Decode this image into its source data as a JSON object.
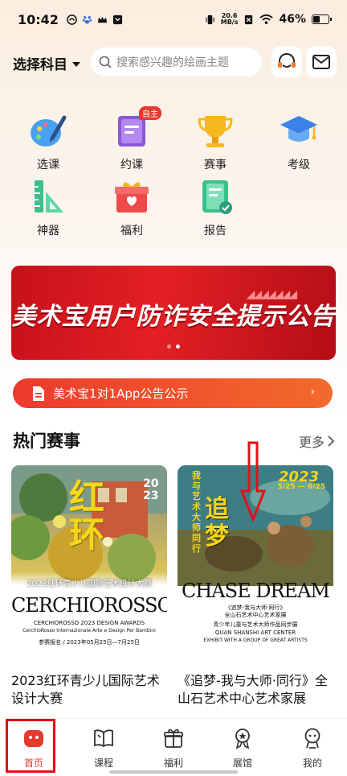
{
  "status": {
    "time": "10:42",
    "speed_top": "20.6",
    "speed_bottom": "MB/s",
    "battery": "46%"
  },
  "header": {
    "subject": "选择科目",
    "search_placeholder": "搜索感兴趣的绘画主题"
  },
  "grid": [
    {
      "label": "选课",
      "icon": "palette-icon"
    },
    {
      "label": "约课",
      "icon": "book-icon",
      "badge": "自主"
    },
    {
      "label": "赛事",
      "icon": "trophy-icon"
    },
    {
      "label": "考级",
      "icon": "graduation-cap-icon"
    },
    {
      "label": "神器",
      "icon": "ruler-icon"
    },
    {
      "label": "福利",
      "icon": "gift-icon"
    },
    {
      "label": "报告",
      "icon": "report-icon"
    }
  ],
  "banner": {
    "text": "美术宝用户防诈安全提示公告"
  },
  "notice": {
    "text": "美术宝1对1App公告公示"
  },
  "section": {
    "title": "热门赛事",
    "more": "更多"
  },
  "cards": [
    {
      "title": "2023红环青少儿国际艺术设计大赛",
      "big": "红环",
      "year": "2023",
      "banner_line": "2023红环青少儿国际艺术设计大赛",
      "brand": "CERCHIOROSSO",
      "sub1": "CERCHIOROSSO 2023 DESIGN AWARDS",
      "sub2": "CerchioRosso Internazionale Arte e Design Per Bambini",
      "dates": "参赛报名 / 2023年05月25日—7月25日"
    },
    {
      "title": "《追梦-我与大师·同行》全山石艺术中心艺术家展",
      "big": "追梦",
      "year": "2023",
      "date_range": "5/25 — 6/25",
      "side": "我与艺术大师同行",
      "brand": "CHASE DREAM",
      "sub1": "《追梦-我与大师·同行》",
      "sub2": "全山石艺术中心艺术家展",
      "sub3": "青少年儿童与艺术大师作品同步展",
      "sub4": "QUAN SHANSHI ART CENTER",
      "sub5": "EXHIBIT WITH A GROUP OF GREAT ARTISTS"
    }
  ],
  "tabs": [
    {
      "label": "首页",
      "icon": "home-icon"
    },
    {
      "label": "课程",
      "icon": "book-open-icon"
    },
    {
      "label": "福利",
      "icon": "gift-icon"
    },
    {
      "label": "展馆",
      "icon": "medal-icon"
    },
    {
      "label": "我的",
      "icon": "profile-icon"
    }
  ],
  "colors": {
    "accent": "#E53A2E",
    "banner": "#D81E22",
    "annotation": "#E0111A"
  }
}
